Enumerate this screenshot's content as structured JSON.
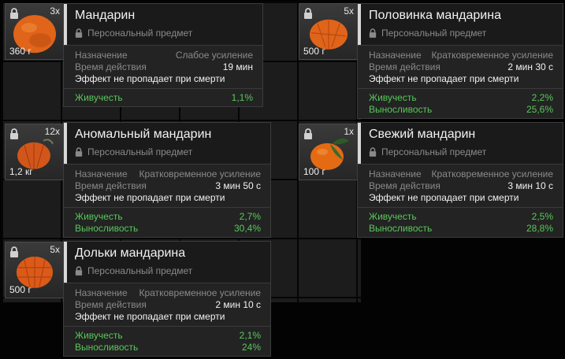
{
  "items": [
    {
      "count": "3x",
      "weight": "360 г",
      "title": "Мандарин",
      "personal": "Персональный предмет",
      "purpose_label": "Назначение",
      "purpose_value": "Слабое усиление",
      "duration_label": "Время действия",
      "duration_value": "19 мин",
      "note": "Эффект не пропадает при смерти",
      "stats": [
        {
          "name": "Живучесть",
          "value": "1,1%"
        }
      ]
    },
    {
      "count": "5x",
      "weight": "500 г",
      "title": "Половинка мандарина",
      "personal": "Персональный предмет",
      "purpose_label": "Назначение",
      "purpose_value": "Кратковременное усиление",
      "duration_label": "Время действия",
      "duration_value": "2 мин 30 с",
      "note": "Эффект не пропадает при смерти",
      "stats": [
        {
          "name": "Живучесть",
          "value": "2,2%"
        },
        {
          "name": "Выносливость",
          "value": "25,6%"
        }
      ]
    },
    {
      "count": "12x",
      "weight": "1,2 кг",
      "title": "Аномальный мандарин",
      "personal": "Персональный предмет",
      "purpose_label": "Назначение",
      "purpose_value": "Кратковременное усиление",
      "duration_label": "Время действия",
      "duration_value": "3 мин 50 с",
      "note": "Эффект не пропадает при смерти",
      "stats": [
        {
          "name": "Живучесть",
          "value": "2,7%"
        },
        {
          "name": "Выносливость",
          "value": "30,4%"
        }
      ]
    },
    {
      "count": "1x",
      "weight": "100 г",
      "title": "Свежий мандарин",
      "personal": "Персональный предмет",
      "purpose_label": "Назначение",
      "purpose_value": "Кратковременное усиление",
      "duration_label": "Время действия",
      "duration_value": "3 мин 10 с",
      "note": "Эффект не пропадает при смерти",
      "stats": [
        {
          "name": "Живучесть",
          "value": "2,5%"
        },
        {
          "name": "Выносливость",
          "value": "28,8%"
        }
      ]
    },
    {
      "count": "5x",
      "weight": "500 г",
      "title": "Дольки мандарина",
      "personal": "Персональный предмет",
      "purpose_label": "Назначение",
      "purpose_value": "Кратковременное усиление",
      "duration_label": "Время действия",
      "duration_value": "2 мин 10 с",
      "note": "Эффект не пропадает при смерти",
      "stats": [
        {
          "name": "Живучесть",
          "value": "2,1%"
        },
        {
          "name": "Выносливость",
          "value": "24%"
        }
      ]
    }
  ],
  "colors": {
    "stat_green": "#58c85a",
    "accent_bar": "#d8d8d8",
    "fruit_orange": "#e0641a"
  },
  "icons": {
    "lock": "lock-icon",
    "fruit": "tangerine-icon"
  }
}
